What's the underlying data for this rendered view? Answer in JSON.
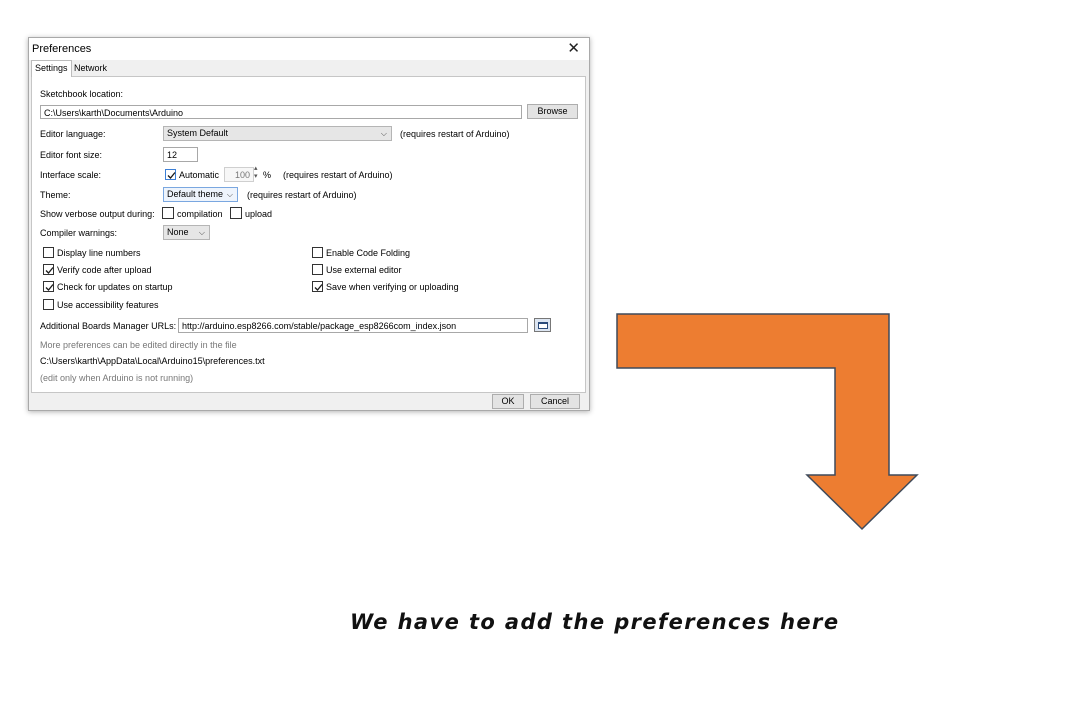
{
  "dialog": {
    "title": "Preferences",
    "tabs": [
      "Settings",
      "Network"
    ],
    "sketchbook_label": "Sketchbook location:",
    "sketchbook_path": "C:\\Users\\karth\\Documents\\Arduino",
    "browse": "Browse",
    "editor_language_label": "Editor language:",
    "editor_language_value": "System Default",
    "requires_restart": "(requires restart of Arduino)",
    "font_size_label": "Editor font size:",
    "font_size_value": "12",
    "interface_scale_label": "Interface scale:",
    "automatic_label": "Automatic",
    "scale_value": "100",
    "percent": "%",
    "theme_label": "Theme:",
    "theme_value": "Default theme",
    "verbose_label": "Show verbose output during:",
    "compilation": "compilation",
    "upload": "upload",
    "compiler_warnings_label": "Compiler warnings:",
    "compiler_warnings_value": "None",
    "options_left": [
      {
        "label": "Display line numbers",
        "checked": false
      },
      {
        "label": "Verify code after upload",
        "checked": true
      },
      {
        "label": "Check for updates on startup",
        "checked": true
      },
      {
        "label": "Use accessibility features",
        "checked": false
      }
    ],
    "options_right": [
      {
        "label": "Enable Code Folding",
        "checked": false
      },
      {
        "label": "Use external editor",
        "checked": false
      },
      {
        "label": "Save when verifying or uploading",
        "checked": true
      }
    ],
    "boards_label": "Additional Boards Manager URLs:",
    "boards_url": "http://arduino.esp8266.com/stable/package_esp8266com_index.json",
    "more_prefs": "More preferences can be edited directly in the file",
    "prefs_path": "C:\\Users\\karth\\AppData\\Local\\Arduino15\\preferences.txt",
    "edit_note": "(edit only when Arduino is not running)",
    "ok": "OK",
    "cancel": "Cancel"
  },
  "annotation": {
    "caption": "We have to add the preferences here",
    "arrow_color": "#ed7d31",
    "arrow_stroke": "#3f4a5a"
  }
}
